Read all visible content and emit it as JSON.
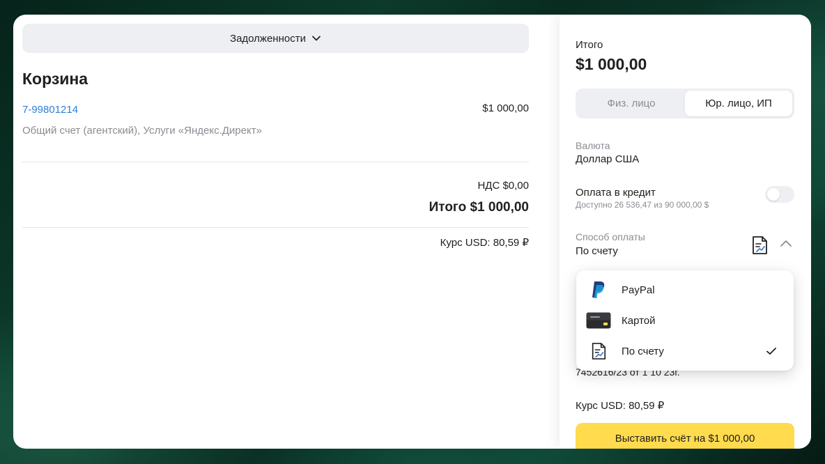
{
  "debts": {
    "label": "Задолженности"
  },
  "cart": {
    "title": "Корзина",
    "order_id": "7-99801214",
    "order_amount": "$1 000,00",
    "order_description": "Общий счет (агентский), Услуги «Яндекс.Директ»",
    "vat": "НДС $0,00",
    "total": "Итого $1 000,00",
    "rate": "Курс USD:  80,59 ₽"
  },
  "summary": {
    "total_label": "Итого",
    "total_value": "$1 000,00",
    "segments": [
      {
        "label": "Физ. лицо",
        "active": false
      },
      {
        "label": "Юр. лицо, ИП",
        "active": true
      }
    ],
    "currency_label": "Валюта",
    "currency_value": "Доллар США",
    "credit_label": "Оплата в кредит",
    "credit_available": "Доступно 26 536,47 из 90 000,00 $",
    "credit_enabled": false,
    "method_label": "Способ оплаты",
    "method_value": "По счету",
    "contract_text": "7452616/23 от 1 10 23г.",
    "rate": "Курс USD:  80,59 ₽",
    "pay_button": "Выставить счёт на $1 000,00"
  },
  "payment_methods": [
    {
      "label": "PayPal",
      "icon": "paypal-icon",
      "selected": false
    },
    {
      "label": "Картой",
      "icon": "card-icon",
      "selected": false
    },
    {
      "label": "По счету",
      "icon": "invoice-icon",
      "selected": true
    }
  ],
  "colors": {
    "accent_button": "#ffdb4d",
    "link": "#2b7fd9",
    "muted_text": "#8a8c92",
    "paypal_dark": "#253b80",
    "paypal_light": "#179bd7"
  }
}
